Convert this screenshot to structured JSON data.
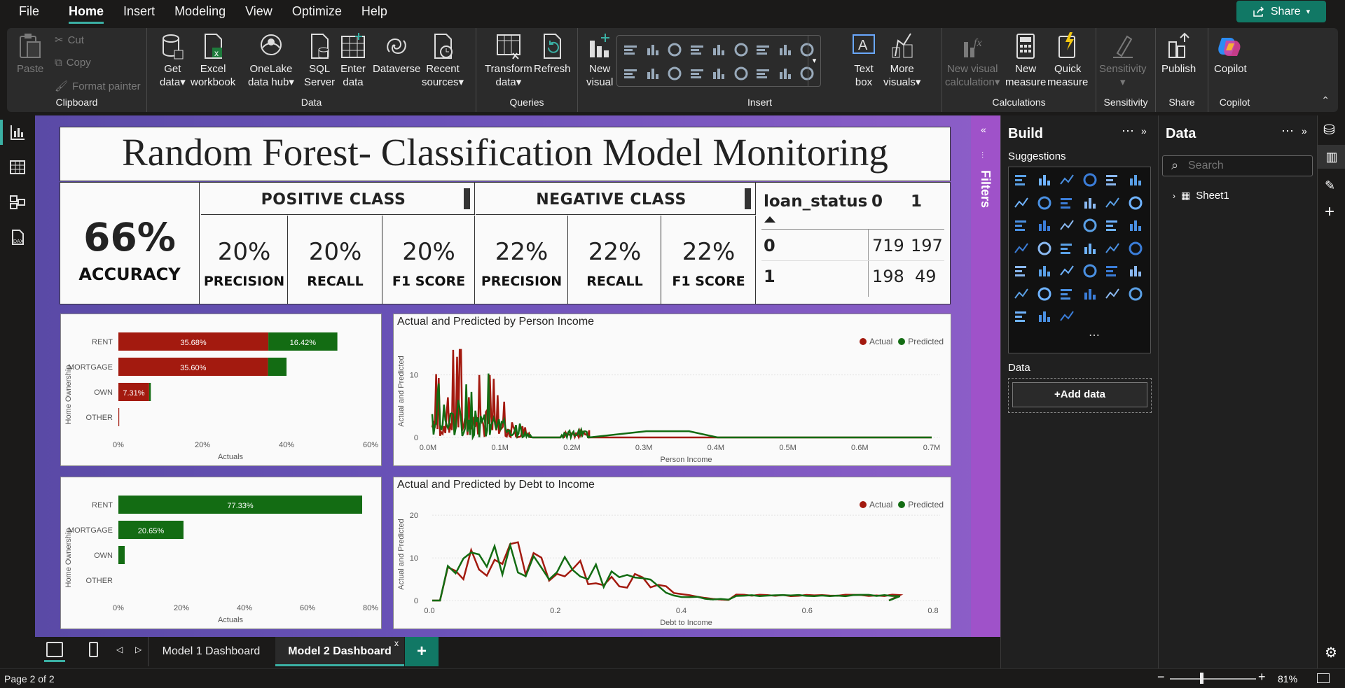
{
  "menu": [
    "File",
    "Home",
    "Insert",
    "Modeling",
    "View",
    "Optimize",
    "Help"
  ],
  "share_label": "Share",
  "ribbon": {
    "clipboard": {
      "paste": "Paste",
      "cut": "Cut",
      "copy": "Copy",
      "format_painter": "Format painter",
      "label": "Clipboard"
    },
    "data": {
      "get_data_1": "Get",
      "get_data_2": "data",
      "excel_1": "Excel",
      "excel_2": "workbook",
      "onelake_1": "OneLake",
      "onelake_2": "data hub",
      "sql_1": "SQL",
      "sql_2": "Server",
      "enter_1": "Enter",
      "enter_2": "data",
      "dataverse": "Dataverse",
      "recent_1": "Recent",
      "recent_2": "sources",
      "label": "Data"
    },
    "queries": {
      "transform_1": "Transform",
      "transform_2": "data",
      "refresh": "Refresh",
      "label": "Queries"
    },
    "insert": {
      "new_visual_1": "New",
      "new_visual_2": "visual",
      "text_box_1": "Text",
      "text_box_2": "box",
      "more_1": "More",
      "more_2": "visuals",
      "label": "Insert"
    },
    "calculations": {
      "new_calc_1": "New visual",
      "new_calc_2": "calculation",
      "new_measure_1": "New",
      "new_measure_2": "measure",
      "quick_1": "Quick",
      "quick_2": "measure",
      "label": "Calculations"
    },
    "sensitivity": {
      "btn": "Sensitivity",
      "label": "Sensitivity"
    },
    "share": {
      "publish": "Publish",
      "label": "Share"
    },
    "copilot": {
      "btn": "Copilot",
      "label": "Copilot"
    }
  },
  "report": {
    "title": "Random Forest- Classification Model Monitoring",
    "accuracy": {
      "value": "66%",
      "label": "ACCURACY"
    },
    "positive": {
      "header": "POSITIVE CLASS",
      "precision": "20%",
      "recall": "20%",
      "f1": "20%"
    },
    "negative": {
      "header": "NEGATIVE CLASS",
      "precision": "22%",
      "recall": "22%",
      "f1": "22%"
    },
    "metric_labels": {
      "precision": "PRECISION",
      "recall": "RECALL",
      "f1": "F1 SCORE"
    },
    "matrix": {
      "field": "loan_status",
      "col0": "0",
      "col1": "1",
      "rows": [
        {
          "label": "0",
          "v0": "719",
          "v1": "197"
        },
        {
          "label": "1",
          "v0": "198",
          "v1": "49"
        }
      ]
    }
  },
  "chart_data": [
    {
      "type": "bar",
      "categories": [
        "RENT",
        "MORTGAGE",
        "OWN",
        "OTHER"
      ],
      "series": [
        {
          "name": "Actual",
          "values": [
            35.68,
            35.6,
            7.31,
            0.2
          ]
        },
        {
          "name": "Predicted",
          "values": [
            16.42,
            4.4,
            0.4,
            0
          ]
        }
      ],
      "labels": [
        "35.68%",
        "16.42%",
        "35.60%",
        "7.31%"
      ],
      "xlabel": "Actuals",
      "ylabel": "Home Ownership",
      "xticks": [
        "0%",
        "20%",
        "40%",
        "60%"
      ],
      "xlim": [
        0,
        60
      ]
    },
    {
      "type": "line",
      "title": "Actual and Predicted by Person Income",
      "xlabel": "Person Income",
      "ylabel": "Actual and Predicted",
      "xticks": [
        "0.0M",
        "0.1M",
        "0.2M",
        "0.3M",
        "0.4M",
        "0.5M",
        "0.6M",
        "0.7M"
      ],
      "yticks": [
        "0",
        "10"
      ],
      "legend": [
        "Actual",
        "Predicted"
      ]
    },
    {
      "type": "bar",
      "categories": [
        "RENT",
        "MORTGAGE",
        "OWN",
        "OTHER"
      ],
      "values": [
        77.33,
        20.65,
        2.0,
        0
      ],
      "labels": [
        "77.33%",
        "20.65%"
      ],
      "xlabel": "Actuals",
      "ylabel": "Home Ownership",
      "xticks": [
        "0%",
        "20%",
        "40%",
        "60%",
        "80%"
      ],
      "xlim": [
        0,
        80
      ]
    },
    {
      "type": "line",
      "title": "Actual and Predicted by Debt to Income",
      "xlabel": "Debt to Income",
      "ylabel": "Actual and Predicted",
      "xticks": [
        "0.0",
        "0.2",
        "0.4",
        "0.6",
        "0.8"
      ],
      "yticks": [
        "0",
        "10",
        "20"
      ],
      "legend": [
        "Actual",
        "Predicted"
      ]
    }
  ],
  "filters_label": "Filters",
  "build": {
    "title": "Build",
    "suggestions": "Suggestions",
    "data_label": "Data",
    "add_data": "+Add data"
  },
  "data_pane": {
    "title": "Data",
    "search_placeholder": "Search",
    "table": "Sheet1"
  },
  "tabs": [
    "Model 1 Dashboard",
    "Model 2 Dashboard"
  ],
  "status": {
    "page": "Page 2 of 2",
    "zoom": "81%"
  },
  "colors": {
    "actual": "#a31a0f",
    "predicted": "#136c13",
    "accent": "#117865"
  }
}
